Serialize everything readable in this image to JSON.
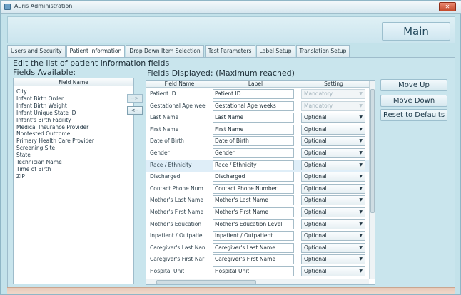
{
  "window": {
    "title": "Auris Administration",
    "close_symbol": "✕"
  },
  "header": {
    "main_button": "Main"
  },
  "tabs": [
    {
      "label": "Users and Security"
    },
    {
      "label": "Patient Information"
    },
    {
      "label": "Drop Down Item Selection"
    },
    {
      "label": "Test Parameters"
    },
    {
      "label": "Label Setup"
    },
    {
      "label": "Translation Setup"
    }
  ],
  "active_tab": "Patient Information",
  "page": {
    "heading": "Edit the list of patient information fields",
    "available_title": "Fields Available:",
    "displayed_title": "Fields Displayed: (Maximum reached)"
  },
  "available": {
    "column_header": "Field Name",
    "items": [
      "City",
      "Infant Birth Order",
      "Infant Birth Weight",
      "Infant Unique State ID",
      "Infant's Birth Facility",
      "Medical Insurance Provider",
      "Nontested Outcome",
      "Primary Health Care Provider",
      "Screening Site",
      "State",
      "Technician Name",
      "Time of Birth",
      "ZIP"
    ]
  },
  "move_buttons": {
    "add": "-->",
    "remove": "<--"
  },
  "displayed": {
    "columns": {
      "field_name": "Field Name",
      "label": "Label",
      "setting": "Setting"
    },
    "rows": [
      {
        "field": "Patient ID",
        "label": "Patient ID",
        "setting": "Mandatory",
        "disabled": true
      },
      {
        "field": "Gestational Age wee",
        "label": "Gestational Age weeks",
        "setting": "Mandatory",
        "disabled": true
      },
      {
        "field": "Last Name",
        "label": "Last Name",
        "setting": "Optional"
      },
      {
        "field": "First Name",
        "label": "First Name",
        "setting": "Optional"
      },
      {
        "field": "Date of Birth",
        "label": "Date of Birth",
        "setting": "Optional"
      },
      {
        "field": "Gender",
        "label": "Gender",
        "setting": "Optional"
      },
      {
        "field": "Race / Ethnicity",
        "label": "Race / Ethnicity",
        "setting": "Optional",
        "selected": true
      },
      {
        "field": "Discharged",
        "label": "Discharged",
        "setting": "Optional"
      },
      {
        "field": "Contact Phone Num",
        "label": "Contact Phone Number",
        "setting": "Optional"
      },
      {
        "field": "Mother's Last Name",
        "label": "Mother's Last Name",
        "setting": "Optional"
      },
      {
        "field": "Mother's First Name",
        "label": "Mother's First Name",
        "setting": "Optional"
      },
      {
        "field": "Mother's Education",
        "label": "Mother's Education Level",
        "setting": "Optional"
      },
      {
        "field": "Inpatient / Outpatie",
        "label": "Inpatient / Outpatient",
        "setting": "Optional"
      },
      {
        "field": "Caregiver's Last Nan",
        "label": "Caregiver's Last Name",
        "setting": "Optional"
      },
      {
        "field": "Caregiver's First Nar",
        "label": "Caregiver's First Name",
        "setting": "Optional"
      },
      {
        "field": "Hospital Unit",
        "label": "Hospital Unit",
        "setting": "Optional"
      }
    ]
  },
  "side_buttons": {
    "move_up": "Move Up",
    "move_down": "Move Down",
    "reset": "Reset to Defaults"
  },
  "colors": {
    "background": "#c3e2ea",
    "selected_row": "#dfeef8",
    "bottom_bar": "#e7c9b9"
  }
}
